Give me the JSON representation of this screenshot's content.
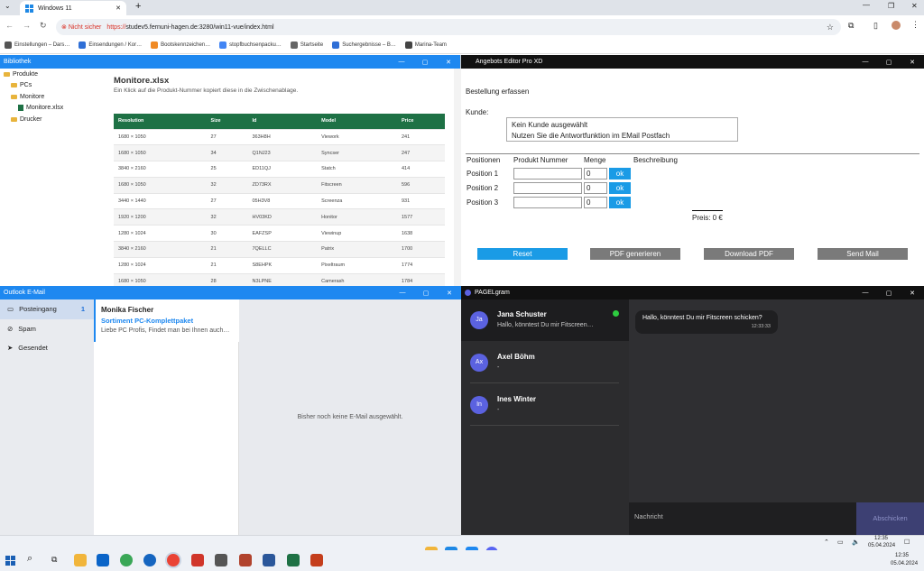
{
  "browser": {
    "tab_title": "Windows 11",
    "new_tab": "+",
    "not_secure": "Nicht sicher",
    "url_scheme": "https://",
    "url_rest": "studev5.fernuni-hagen.de:3280/win11-vue/index.html",
    "bookmarks": [
      {
        "label": "Einstellungen – Dars…",
        "color": "#555555"
      },
      {
        "label": "Einsendungen / Kor…",
        "color": "#2f6fd6"
      },
      {
        "label": "Bootskennzeichen…",
        "color": "#f08a24"
      },
      {
        "label": "stopfbuchsenpacku…",
        "color": "#4285f4"
      },
      {
        "label": "Startseite",
        "color": "#666666"
      },
      {
        "label": "Suchergebnisse – B…",
        "color": "#2f6fd6"
      },
      {
        "label": "Marina-Team",
        "color": "#444444"
      }
    ]
  },
  "bibliothek": {
    "title": "Bibliothek",
    "tree": [
      {
        "label": "Produkte",
        "indent": 0,
        "type": "folder"
      },
      {
        "label": "PCs",
        "indent": 1,
        "type": "folder"
      },
      {
        "label": "Monitore",
        "indent": 1,
        "type": "folder"
      },
      {
        "label": "Monitore.xlsx",
        "indent": 2,
        "type": "xlsx"
      },
      {
        "label": "Drucker",
        "indent": 1,
        "type": "folder"
      }
    ],
    "file_title": "Monitore.xlsx",
    "hint": "Ein Klick auf die Produkt-Nummer kopiert diese in die Zwischenablage.",
    "columns": [
      "Resolution",
      "Size",
      "Id",
      "Model",
      "Price"
    ],
    "rows": [
      [
        "1680 × 1050",
        "27",
        "363H8H",
        "Viework",
        "241"
      ],
      [
        "1680 × 1050",
        "34",
        "Q1NJ23",
        "Syncser",
        "247"
      ],
      [
        "3840 × 2160",
        "25",
        "ED11QJ",
        "Statch",
        "414"
      ],
      [
        "1680 × 1050",
        "32",
        "ZD73RX",
        "Fitscreen",
        "596"
      ],
      [
        "3440 × 1440",
        "27",
        "05H3V8",
        "Screenza",
        "931"
      ],
      [
        "1920 × 1200",
        "32",
        "HV03KD",
        "Honitor",
        "1577"
      ],
      [
        "1280 × 1024",
        "30",
        "EAFZSP",
        "Viewinup",
        "1638"
      ],
      [
        "3840 × 2160",
        "21",
        "7QELLC",
        "Patrix",
        "1700"
      ],
      [
        "1280 × 1024",
        "21",
        "S8EHPK",
        "Pixeltraum",
        "1774"
      ],
      [
        "1680 × 1050",
        "28",
        "N3LPNE",
        "Camerash",
        "1784"
      ]
    ]
  },
  "angebots": {
    "title": "Angebots Editor Pro XD",
    "heading": "Bestellung erfassen",
    "kunde_label": "Kunde:",
    "kunde_line1": "Kein Kunde ausgewählt",
    "kunde_line2": "Nutzen Sie die Antwortfunktion im EMail Postfach",
    "col_positionen": "Positionen",
    "col_produkt": "Produkt Nummer",
    "col_menge": "Menge",
    "col_beschreibung": "Beschreibung",
    "positions": [
      {
        "label": "Position 1",
        "menge": "0",
        "ok": "ok"
      },
      {
        "label": "Position 2",
        "menge": "0",
        "ok": "ok"
      },
      {
        "label": "Position 3",
        "menge": "0",
        "ok": "ok"
      }
    ],
    "preis": "Preis: 0 €",
    "buttons": {
      "reset": "Reset",
      "pdf": "PDF generieren",
      "download": "Download PDF",
      "send": "Send Mail"
    },
    "colors": {
      "reset": "#1a9be6",
      "gray": "#7a7a7a"
    }
  },
  "outlook": {
    "title": "Outlook E-Mail",
    "nav": [
      {
        "label": "Posteingang",
        "count": "1"
      },
      {
        "label": "Spam",
        "count": ""
      },
      {
        "label": "Gesendet",
        "count": ""
      }
    ],
    "mail": {
      "sender": "Monika Fischer",
      "subject": "Sortiment PC-Komplettpaket",
      "preview": "Liebe PC Profis, Findet man bei Ihnen auch…"
    },
    "empty_text": "Bisher noch keine E-Mail ausgewählt."
  },
  "pagelgram": {
    "title": "PAGELgram",
    "contacts": [
      {
        "initials": "Ja",
        "name": "Jana Schuster",
        "preview": "Hallo, könntest Du mir Fitscreen…",
        "online": true
      },
      {
        "initials": "Ax",
        "name": "Axel Böhm",
        "preview": "-",
        "online": false
      },
      {
        "initials": "In",
        "name": "Ines Winter",
        "preview": "-",
        "online": false
      }
    ],
    "message": {
      "text": "Hallo, könntest Du mir Fitscreen schicken?",
      "time": "12:33:33"
    },
    "input_placeholder": "Nachricht",
    "send_label": "Abschicken"
  },
  "taskbar": {
    "time": "12:35",
    "date": "05.04.2024",
    "time2": "12:35",
    "date2": "05.04.2024"
  }
}
